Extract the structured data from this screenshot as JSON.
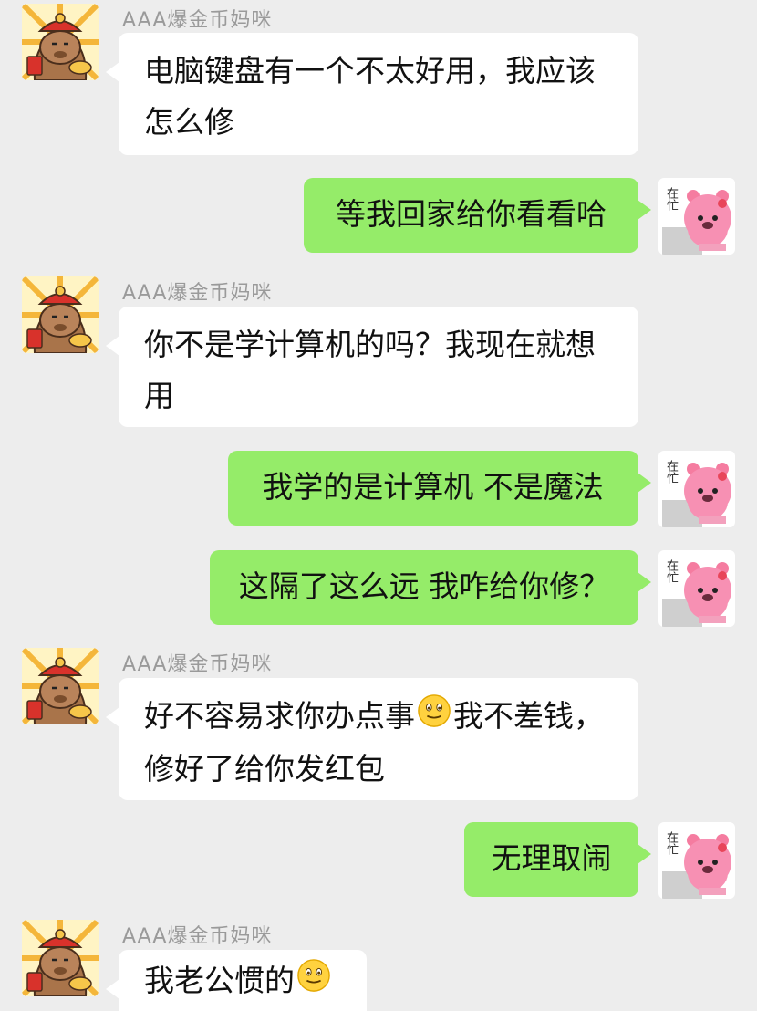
{
  "messages": [
    {
      "side": "left",
      "sender": "AAA爆金币妈咪",
      "lines": [
        "电脑键盘有一个不太好用，我应该",
        "怎么修"
      ]
    },
    {
      "side": "right",
      "text": "等我回家给你看看哈",
      "avatar_text": "在忙"
    },
    {
      "side": "left",
      "sender": "AAA爆金币妈咪",
      "lines": [
        "你不是学计算机的吗？我现在就想",
        "用"
      ]
    },
    {
      "side": "right",
      "text": "我学的是计算机 不是魔法",
      "avatar_text": "在忙"
    },
    {
      "side": "right",
      "text": "这隔了这么远 我咋给你修？",
      "avatar_text": "在忙"
    },
    {
      "side": "left",
      "sender": "AAA爆金币妈咪",
      "line1_a": "好不容易求你办点事",
      "line1_b": "我不差钱，",
      "line2": "修好了给你发红包"
    },
    {
      "side": "right",
      "text": "无理取闹",
      "avatar_text": "在忙"
    },
    {
      "side": "left",
      "sender": "AAA爆金币妈咪",
      "text": "我老公惯的"
    }
  ],
  "icons": {
    "left_avatar": "capybara-god-of-wealth-icon",
    "right_avatar": "pink-bear-busy-icon",
    "emoji": "smile-emoji-icon"
  },
  "colors": {
    "background": "#ededed",
    "sent_bubble": "#95ec69",
    "received_bubble": "#ffffff",
    "sender_name": "#9a9a9a"
  }
}
